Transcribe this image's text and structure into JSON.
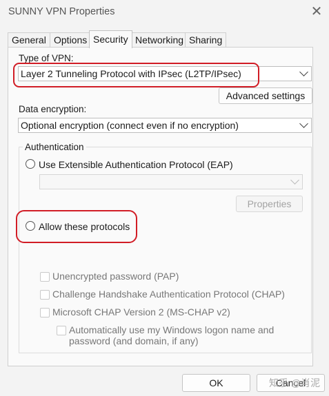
{
  "window": {
    "title": "SUNNY VPN Properties"
  },
  "tabs": [
    {
      "label": "General"
    },
    {
      "label": "Options"
    },
    {
      "label": "Security"
    },
    {
      "label": "Networking"
    },
    {
      "label": "Sharing"
    }
  ],
  "vpn_type": {
    "label": "Type of VPN:",
    "selected": "Layer 2 Tunneling Protocol with IPsec (L2TP/IPsec)",
    "advanced_button": "Advanced settings"
  },
  "encryption": {
    "label": "Data encryption:",
    "selected": "Optional encryption (connect even if no encryption)"
  },
  "authentication": {
    "group_label": "Authentication",
    "eap_option": "Use Extensible Authentication Protocol (EAP)",
    "eap_properties_button": "Properties",
    "allow_option": "Allow these protocols",
    "protocols": [
      {
        "label": "Unencrypted password (PAP)"
      },
      {
        "label": "Challenge Handshake Authentication Protocol (CHAP)"
      },
      {
        "label": "Microsoft CHAP Version 2 (MS-CHAP v2)"
      }
    ],
    "auto_logon_line1": "Automatically use my Windows logon name and",
    "auto_logon_line2": "password (and domain, if any)"
  },
  "footer": {
    "ok": "OK",
    "cancel": "Cancel"
  },
  "watermark": "知乎 @肖泥",
  "colors": {
    "annotation_red": "#d11c25"
  }
}
